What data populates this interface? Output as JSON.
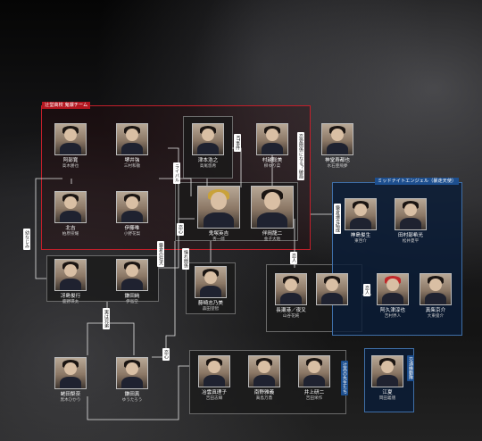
{
  "groups": {
    "tsujido_label": "辻堂高校 鬼爆チーム",
    "midnight_label": "ミッドナイトエンジェル（暴走天使）",
    "teachers_label": "辻高の先生たち",
    "police_label": "交通機動隊"
  },
  "characters": {
    "abe": {
      "name": "阿部寛",
      "actor": "高木勝也"
    },
    "sakai": {
      "name": "堺井強",
      "actor": "三村和敬"
    },
    "kitayoshi": {
      "name": "北吉",
      "actor": "柏原崇耀"
    },
    "ibuki": {
      "name": "伊藤唯",
      "actor": "小野花梨"
    },
    "saeshima": {
      "name": "冴島俊行",
      "actor": "鹿野瑛太"
    },
    "kamata": {
      "name": "鎌田純",
      "actor": "伊島空"
    },
    "tsumoto": {
      "name": "津本浩之",
      "actor": "高尾悠希"
    },
    "murashiba": {
      "name": "村越聡美",
      "actor": "柳ゆり菜"
    },
    "kamizake": {
      "name": "神堂寿都也",
      "actor": "水石亜飛夢"
    },
    "onizuka": {
      "name": "鬼塚英吉",
      "actor": "杏一郎"
    },
    "tomonoi": {
      "name": "伴岡龍二",
      "actor": "金子大地"
    },
    "jinshima": {
      "name": "神島俊生",
      "actor": "東啓介"
    },
    "tamura": {
      "name": "田村部希光",
      "actor": "松井夏平"
    },
    "fujisaki": {
      "name": "藤崎志乃美",
      "actor": "森田望智"
    },
    "nagase": {
      "name": "長瀬港／夜叉",
      "actor": "山谷花純"
    },
    "aoe": {
      "name": "阿久津淳也",
      "actor": "吉村界人"
    },
    "mamiya": {
      "name": "真柴京介",
      "actor": "大東俊介"
    },
    "tsuji": {
      "name": "蛯田梨奈",
      "actor": "黒木ひかり"
    },
    "kamata_m": {
      "name": "鎌田真",
      "actor": "ゆうたろう"
    },
    "saiga": {
      "name": "冶雲真理子",
      "actor": "吉田志織"
    },
    "minamino": {
      "name": "南野雅義",
      "actor": "眞島万鼎"
    },
    "inoue": {
      "name": "井上研二",
      "actor": "吉田栄作"
    },
    "emamoto": {
      "name": "江夏",
      "actor": "岡田義徳"
    }
  },
  "relations": {
    "childhood": "幼なじみ",
    "kt": "KT事件",
    "scrap": "恋愛関係になる？破局",
    "senpai": "ライバル",
    "love1": "恋心",
    "love2": "恋心",
    "love3": "恋心",
    "lover": "恋人",
    "lover2": "恋人",
    "rival": "鎌倉連合結成",
    "bond": "鎌倉の狂犬",
    "siblings": "実は兄弟",
    "sister": "憧れ関係",
    "kamakura": "鎌倉連合会"
  }
}
